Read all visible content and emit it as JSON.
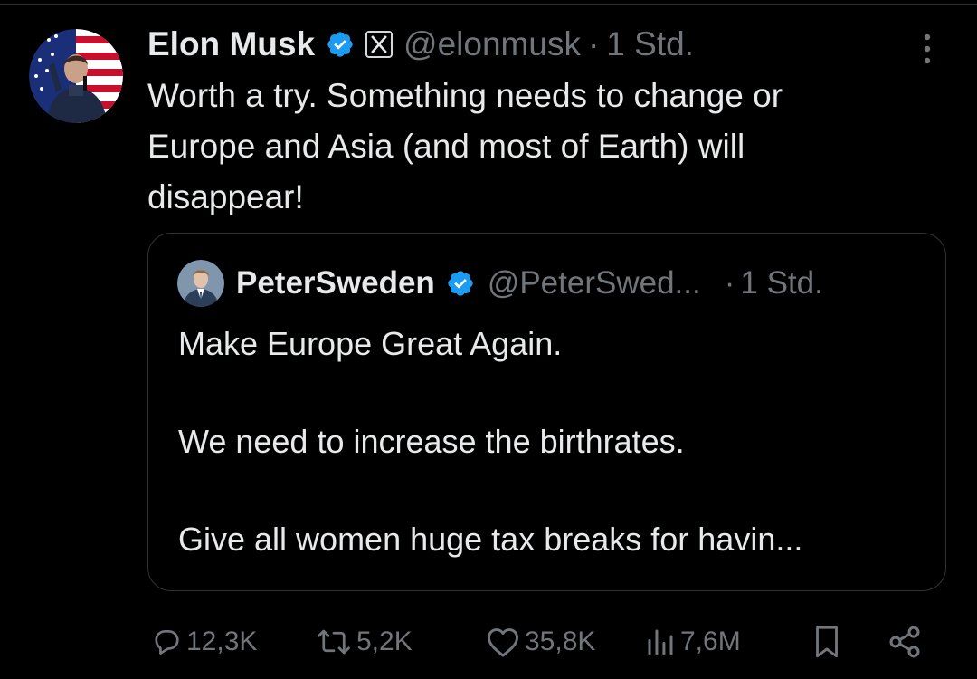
{
  "post": {
    "author": {
      "display_name": "Elon Musk",
      "handle": "@elonmusk",
      "verified": true,
      "affiliation_icon": "x-logo-icon"
    },
    "separator": "·",
    "time": "1 Std.",
    "text": "Worth a try. Something needs to change or\nEurope and Asia (and most of Earth) will\ndisappear!"
  },
  "quoted_post": {
    "author": {
      "display_name": "PeterSweden",
      "handle": "@PeterSwed...",
      "verified": true
    },
    "separator": "·",
    "time": "1 Std.",
    "text": "Make Europe Great Again.\n\nWe need to increase the birthrates.\n\nGive all women huge tax breaks for havin..."
  },
  "actions": {
    "replies": "12,3K",
    "reposts": "5,2K",
    "likes": "35,8K",
    "views": "7,6M"
  },
  "colors": {
    "background": "#000000",
    "text_primary": "#e7e9ea",
    "text_secondary": "#71767b",
    "verified_blue": "#1d9bf0",
    "border": "#2f3336"
  }
}
